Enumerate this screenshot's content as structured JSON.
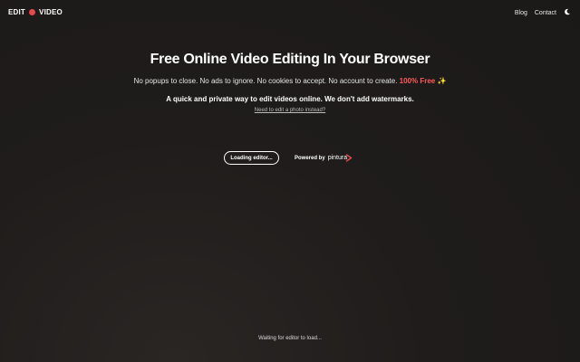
{
  "header": {
    "logo_left": "EDIT",
    "logo_right": "VIDEO",
    "nav": {
      "blog": "Blog",
      "contact": "Contact"
    },
    "theme_icon": "moon-icon"
  },
  "hero": {
    "title": "Free Online Video Editing In Your Browser",
    "subtitle": "No popups to close. No ads to ignore. No cookies to accept. No account to create.",
    "free_badge": "100% Free ✨",
    "tagline": "A quick and private way to edit videos online. We don't add watermarks.",
    "photo_link": "Need to edit a photo instead?"
  },
  "editor": {
    "loading_button": "Loading editor...",
    "powered_by": "Powered by",
    "powered_brand": "pintura",
    "status": "Waiting for editor to load..."
  },
  "colors": {
    "accent": "#e5484d",
    "background": "#1f1c1b"
  }
}
